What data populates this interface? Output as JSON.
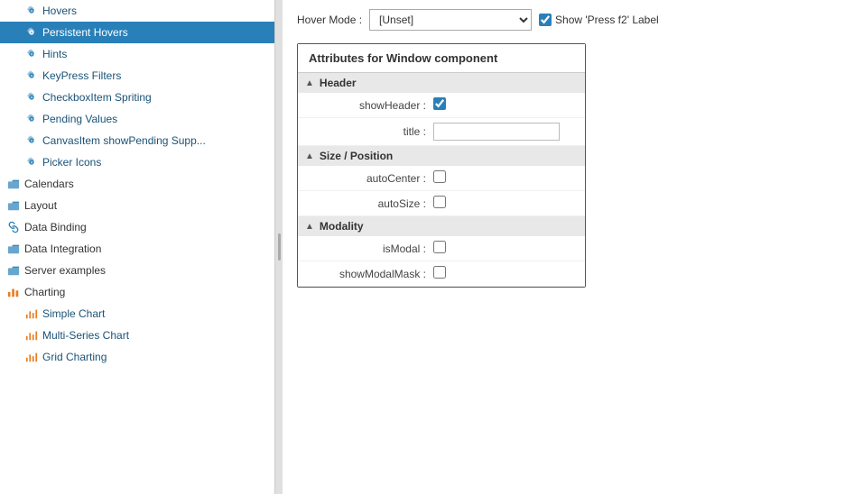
{
  "sidebar": {
    "items": [
      {
        "id": "hovers",
        "label": "Hovers",
        "indent": 1,
        "type": "leaf",
        "icon": "gear"
      },
      {
        "id": "persistent-hovers",
        "label": "Persistent Hovers",
        "indent": 1,
        "type": "leaf",
        "icon": "gear",
        "active": true
      },
      {
        "id": "hints",
        "label": "Hints",
        "indent": 1,
        "type": "leaf",
        "icon": "gear"
      },
      {
        "id": "keypress-filters",
        "label": "KeyPress Filters",
        "indent": 1,
        "type": "leaf",
        "icon": "gear"
      },
      {
        "id": "checkboxitem-spriting",
        "label": "CheckboxItem Spriting",
        "indent": 1,
        "type": "leaf",
        "icon": "gear"
      },
      {
        "id": "pending-values",
        "label": "Pending Values",
        "indent": 1,
        "type": "leaf",
        "icon": "gear"
      },
      {
        "id": "canvasitem-showpending",
        "label": "CanvasItem showPending Supp...",
        "indent": 1,
        "type": "leaf",
        "icon": "gear"
      },
      {
        "id": "picker-icons",
        "label": "Picker Icons",
        "indent": 1,
        "type": "leaf",
        "icon": "gear"
      },
      {
        "id": "calendars",
        "label": "Calendars",
        "indent": 0,
        "type": "section",
        "icon": "folder"
      },
      {
        "id": "layout",
        "label": "Layout",
        "indent": 0,
        "type": "section",
        "icon": "folder"
      },
      {
        "id": "data-binding",
        "label": "Data Binding",
        "indent": 0,
        "type": "section",
        "icon": "link"
      },
      {
        "id": "data-integration",
        "label": "Data Integration",
        "indent": 0,
        "type": "section",
        "icon": "folder"
      },
      {
        "id": "server-examples",
        "label": "Server examples",
        "indent": 0,
        "type": "section",
        "icon": "folder"
      },
      {
        "id": "charting",
        "label": "Charting",
        "indent": 0,
        "type": "section",
        "icon": "chart",
        "expanded": true
      },
      {
        "id": "simple-chart",
        "label": "Simple Chart",
        "indent": 1,
        "type": "leaf",
        "icon": "chart-leaf"
      },
      {
        "id": "multi-series-chart",
        "label": "Multi-Series Chart",
        "indent": 1,
        "type": "leaf",
        "icon": "chart-leaf"
      },
      {
        "id": "grid-charting",
        "label": "Grid Charting",
        "indent": 1,
        "type": "leaf",
        "icon": "chart-leaf"
      }
    ]
  },
  "topbar": {
    "hover_mode_label": "Hover Mode :",
    "hover_mode_value": "[Unset]",
    "show_label": "Show 'Press f2' Label"
  },
  "attributes_panel": {
    "title": "Attributes for Window component",
    "sections": [
      {
        "id": "header",
        "label": "Header",
        "fields": [
          {
            "id": "showHeader",
            "label": "showHeader :",
            "type": "checkbox",
            "checked": true
          },
          {
            "id": "title",
            "label": "title :",
            "type": "text",
            "value": ""
          }
        ]
      },
      {
        "id": "size-position",
        "label": "Size / Position",
        "fields": [
          {
            "id": "autoCenter",
            "label": "autoCenter :",
            "type": "checkbox",
            "checked": false
          },
          {
            "id": "autoSize",
            "label": "autoSize :",
            "type": "checkbox",
            "checked": false
          }
        ]
      },
      {
        "id": "modality",
        "label": "Modality",
        "fields": [
          {
            "id": "isModal",
            "label": "isModal :",
            "type": "checkbox",
            "checked": false
          },
          {
            "id": "showModalMask",
            "label": "showModalMask :",
            "type": "checkbox",
            "checked": false
          }
        ]
      }
    ]
  }
}
